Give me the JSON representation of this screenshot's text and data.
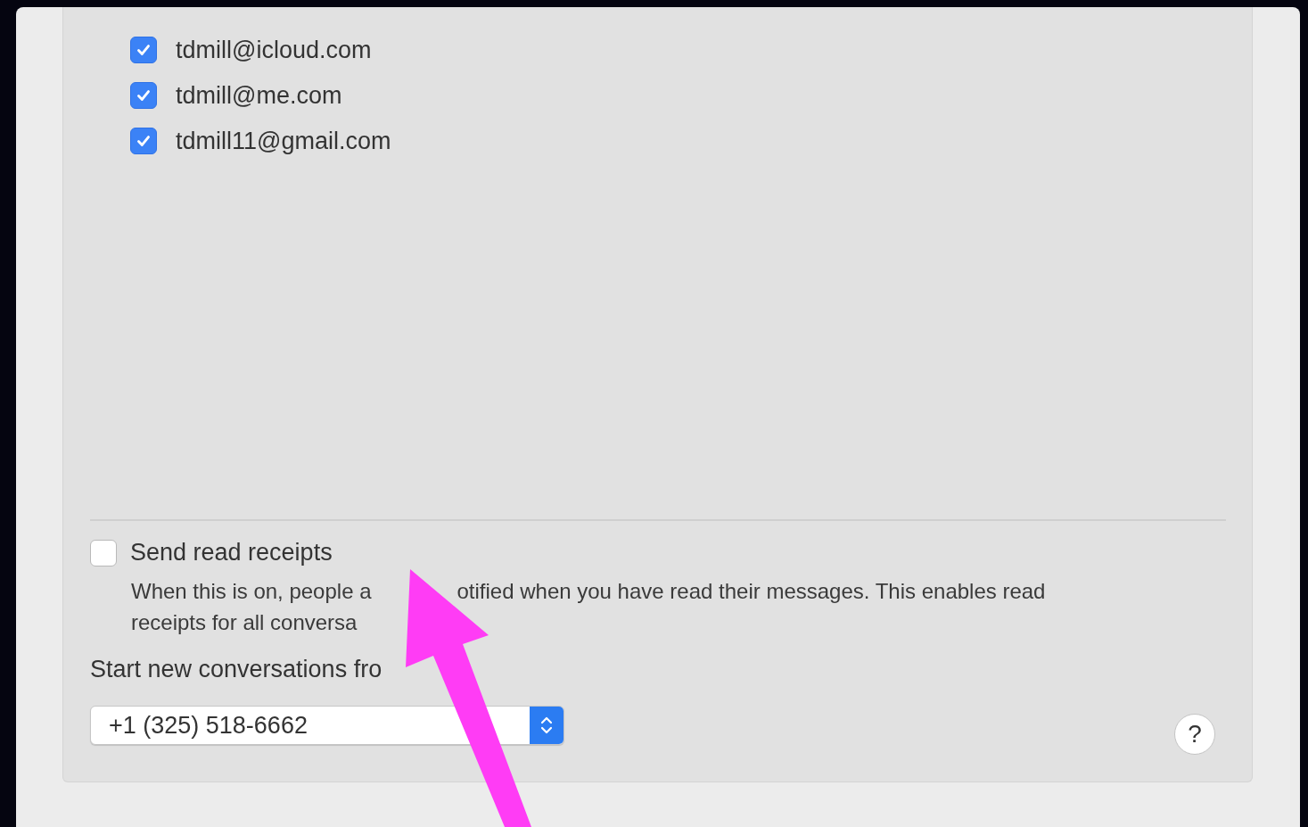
{
  "accounts": [
    {
      "label": "tdmill@icloud.com",
      "checked": true
    },
    {
      "label": "tdmill@me.com",
      "checked": true
    },
    {
      "label": "tdmill11@gmail.com",
      "checked": true
    }
  ],
  "read_receipts": {
    "label": "Send read receipts",
    "checked": false,
    "description_line_1": [
      "When this is on, people a",
      "otified when you have read their messages. This enables read"
    ],
    "description_line_2": "receipts for all conversa"
  },
  "start_from": {
    "label": "Start new conversations fro",
    "value": "+1 (325) 518-6662"
  },
  "help_button": "?"
}
